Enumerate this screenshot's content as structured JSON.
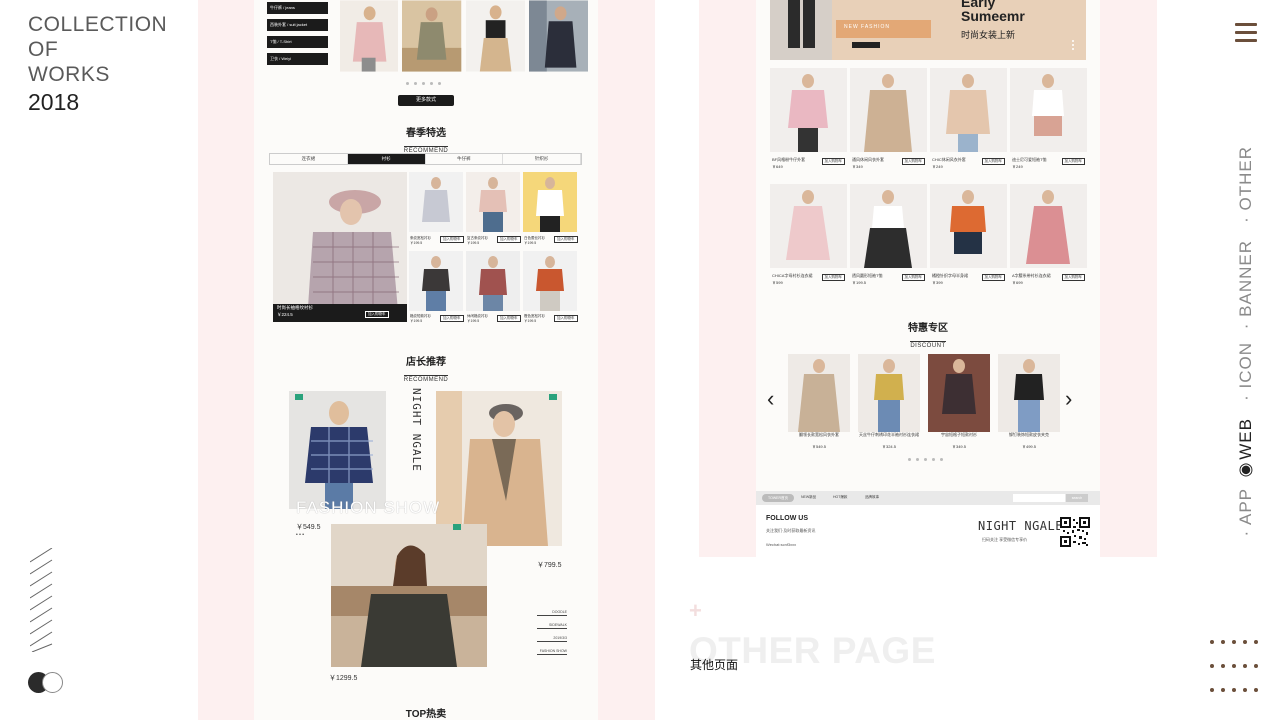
{
  "portfolio": {
    "line1": "COLLECTION OF",
    "line2": "WORKS",
    "year": "2018"
  },
  "side_nav": {
    "items": [
      {
        "label": "· OTHER",
        "active": false
      },
      {
        "label": "· BANNER",
        "active": false
      },
      {
        "label": "· ICON",
        "active": false
      },
      {
        "label": "◉WEB",
        "active": true
      },
      {
        "label": "· APP",
        "active": false
      }
    ],
    "accent_color": "#6b4f3b"
  },
  "mock1": {
    "categories": [
      "牛仔裤 / jeans",
      "西装外套 / suit jacket",
      "T恤 / T-Shirt",
      "卫衣 / Weiyi"
    ],
    "more_button": "更多款式",
    "spring": {
      "cn": "春季特选",
      "en": "RECOMMEND"
    },
    "tabs": [
      "连衣裙",
      "衬衫",
      "牛仔裤",
      "针织衫"
    ],
    "feature": {
      "name": "时尚长袖格纹衬衫",
      "price": "￥224.5",
      "cart": "加入购物车"
    },
    "small_products": [
      {
        "name": "条纹宽松衬衫",
        "price": "￥199.5",
        "cart": "加入购物车"
      },
      {
        "name": "复古条纹衬衫",
        "price": "￥199.5",
        "cart": "加入购物车"
      },
      {
        "name": "白色蕾丝衬衫",
        "price": "￥199.5",
        "cart": "加入购物车"
      },
      {
        "name": "格纹短款衬衫",
        "price": "￥199.5",
        "cart": "加入购物车"
      },
      {
        "name": "休闲格纹衬衫",
        "price": "￥199.5",
        "cart": "加入购物车"
      },
      {
        "name": "橙色宽松衬衫",
        "price": "￥199.5",
        "cart": "加入购物车"
      }
    ],
    "manager": {
      "cn": "店长推荐",
      "en": "RECOMMEND"
    },
    "brand_vertical": "NIGHT NGALE",
    "fashion_show": "FASHION SHOW",
    "price_1": "￥549.5",
    "dots_1": "• • •",
    "price_2": "￥799.5",
    "price_3": "￥1299.5",
    "side_list": [
      "DOODLE",
      "SIDEWALK",
      "2019/3/3",
      "FASHION SHOW"
    ],
    "top_hot": "TOP热卖"
  },
  "mock2": {
    "banner": {
      "new_fashion": "NEW FASHION",
      "headline_1": "Early",
      "headline_2": "Sumeemr",
      "sub": "时尚女装上新"
    },
    "cart_label": "加入购物车",
    "row1": [
      {
        "name": "BF风格粉牛仔外套",
        "price": "￥649"
      },
      {
        "name": "通风休闲风衣外套",
        "price": "￥349"
      },
      {
        "name": "CHIC休闲风衣外套",
        "price": "￥249"
      },
      {
        "name": "迪士尼可爱短袖T恤",
        "price": "￥249"
      }
    ],
    "row2": [
      {
        "name": "CHICA字母衬衫连衣裙",
        "price": "￥599"
      },
      {
        "name": "透风圆形短袖T恤",
        "price": "￥199.5"
      },
      {
        "name": "橘橙针织字母半身裙",
        "price": "￥399"
      },
      {
        "name": "A字腰系带衬衫连衣裙",
        "price": "￥699"
      }
    ],
    "discount": {
      "cn": "特惠专区",
      "en": "DISCOUNT"
    },
    "carousel": [
      {
        "name": "翻领长款宽松风衣外套",
        "price": "￥549.5"
      },
      {
        "name": "天丝牛仔刺绣印花半袖衬衫连衣裙",
        "price": "￥324.5"
      },
      {
        "name": "宇宙短格子短款衬衫",
        "price": "￥349.5"
      },
      {
        "name": "铆钉装饰短款皮衣夹克",
        "price": "￥499.5"
      }
    ],
    "footer_nav": [
      "TOWER首页",
      "NEW新品",
      "HOT爆款",
      "品牌故事"
    ],
    "search_btn": "search",
    "follow": "FOLLOW US",
    "footer_line1": "关注我们·及时获取最新资讯",
    "footer_line2": "Wechat:scnf3xxx",
    "brand": "NIGHT NGALE",
    "brand_sub": "扫码关注  享受微信专享价"
  },
  "other_page": {
    "en": "OTHER PAGE",
    "cn": "其他页面"
  }
}
